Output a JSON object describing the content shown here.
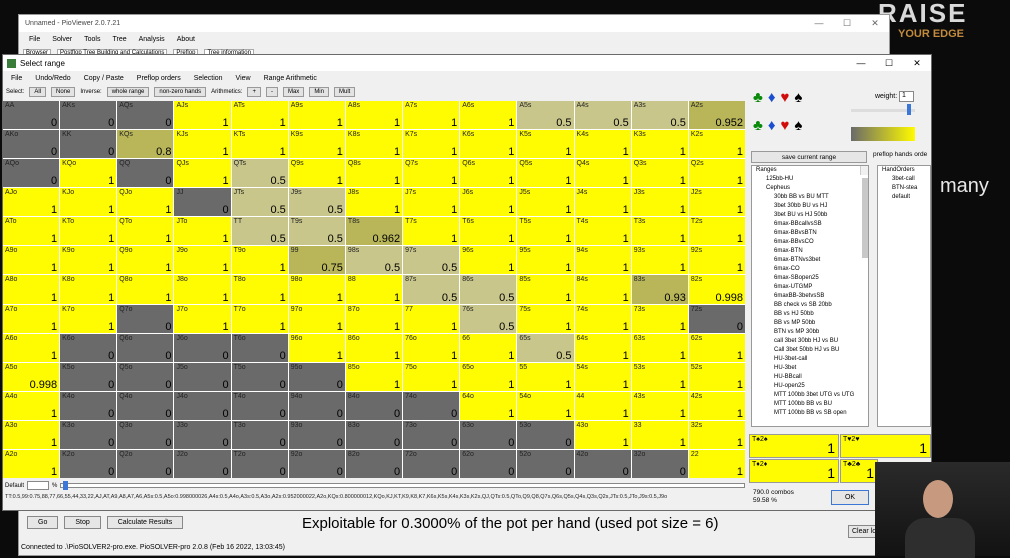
{
  "bg_window": {
    "title": "Unnamed - PioViewer 2.0.7.21",
    "menu": [
      "File",
      "Solver",
      "Tools",
      "Tree",
      "Analysis",
      "About"
    ],
    "tabs": [
      "Browser",
      "Postflop Tree Building and Calculations",
      "Preflop",
      "Tree information"
    ],
    "buttons": [
      "Go",
      "Stop",
      "Calculate Results"
    ],
    "explanation": "Exploitable for 0.3000% of the pot per hand (used pot size = 6)",
    "clear_log": "Clear log",
    "status": "Connected to .\\PioSOLVER2-pro.exe. PioSOLVER-pro 2.0.8 (Feb 16 2022, 13:03:45)"
  },
  "main_window": {
    "title": "Select range",
    "menu": [
      "File",
      "Undo/Redo",
      "Copy / Paste",
      "Preflop orders",
      "Selection",
      "View",
      "Range Arithmetic"
    ],
    "toolbar": {
      "select_label": "Select:",
      "all": "All",
      "none": "None",
      "inverse_label": "Inverse:",
      "whole_range": "whole range",
      "non_zero": "non-zero hands",
      "arith_label": "Arithmetics:",
      "plus": "+",
      "minus": "-",
      "max": "Max",
      "min": "Min",
      "mult": "Mult"
    },
    "default_label": "Default",
    "pct": "%",
    "range_string": "TT:0.5,99:0.75,88,77,66,55,44,33,22,AJ,AT,A9,A8,A7,A6,A5s:0.5,A5o:0.998000026,A4s:0.5,A4o,A3s:0.5,A3o,A2s:0.952000022,A2o,KQs:0.800000012,KQo,KJ,KT,K9,K8,K7,K6s,K5s,K4s,K3s,K2s,QJ,QTs:0.5,QTo,Q9,Q8,Q7s,Q6s,Q5s,Q4s,Q3s,Q2s,JTs:0.5,JTo,J9s:0.5,J9o"
  },
  "grid": [
    [
      [
        "AA",
        "0"
      ],
      [
        "AKs",
        "0"
      ],
      [
        "AQs",
        "0"
      ],
      [
        "AJs",
        "1"
      ],
      [
        "ATs",
        "1"
      ],
      [
        "A9s",
        "1"
      ],
      [
        "A8s",
        "1"
      ],
      [
        "A7s",
        "1"
      ],
      [
        "A6s",
        "1"
      ],
      [
        "A5s",
        "0.5"
      ],
      [
        "A4s",
        "0.5"
      ],
      [
        "A3s",
        "0.5"
      ],
      [
        "A2s",
        "0.952"
      ]
    ],
    [
      [
        "AKo",
        "0"
      ],
      [
        "KK",
        "0"
      ],
      [
        "KQs",
        "0.8"
      ],
      [
        "KJs",
        "1"
      ],
      [
        "KTs",
        "1"
      ],
      [
        "K9s",
        "1"
      ],
      [
        "K8s",
        "1"
      ],
      [
        "K7s",
        "1"
      ],
      [
        "K6s",
        "1"
      ],
      [
        "K5s",
        "1"
      ],
      [
        "K4s",
        "1"
      ],
      [
        "K3s",
        "1"
      ],
      [
        "K2s",
        "1"
      ]
    ],
    [
      [
        "AQo",
        "0"
      ],
      [
        "KQo",
        "1"
      ],
      [
        "QQ",
        "0"
      ],
      [
        "QJs",
        "1"
      ],
      [
        "QTs",
        "0.5"
      ],
      [
        "Q9s",
        "1"
      ],
      [
        "Q8s",
        "1"
      ],
      [
        "Q7s",
        "1"
      ],
      [
        "Q6s",
        "1"
      ],
      [
        "Q5s",
        "1"
      ],
      [
        "Q4s",
        "1"
      ],
      [
        "Q3s",
        "1"
      ],
      [
        "Q2s",
        "1"
      ]
    ],
    [
      [
        "AJo",
        "1"
      ],
      [
        "KJo",
        "1"
      ],
      [
        "QJo",
        "1"
      ],
      [
        "JJ",
        "0"
      ],
      [
        "JTs",
        "0.5"
      ],
      [
        "J9s",
        "0.5"
      ],
      [
        "J8s",
        "1"
      ],
      [
        "J7s",
        "1"
      ],
      [
        "J6s",
        "1"
      ],
      [
        "J5s",
        "1"
      ],
      [
        "J4s",
        "1"
      ],
      [
        "J3s",
        "1"
      ],
      [
        "J2s",
        "1"
      ]
    ],
    [
      [
        "ATo",
        "1"
      ],
      [
        "KTo",
        "1"
      ],
      [
        "QTo",
        "1"
      ],
      [
        "JTo",
        "1"
      ],
      [
        "TT",
        "0.5"
      ],
      [
        "T9s",
        "0.5"
      ],
      [
        "T8s",
        "0.962"
      ],
      [
        "T7s",
        "1"
      ],
      [
        "T6s",
        "1"
      ],
      [
        "T5s",
        "1"
      ],
      [
        "T4s",
        "1"
      ],
      [
        "T3s",
        "1"
      ],
      [
        "T2s",
        "1"
      ]
    ],
    [
      [
        "A9o",
        "1"
      ],
      [
        "K9o",
        "1"
      ],
      [
        "Q9o",
        "1"
      ],
      [
        "J9o",
        "1"
      ],
      [
        "T9o",
        "1"
      ],
      [
        "99",
        "0.75"
      ],
      [
        "98s",
        "0.5"
      ],
      [
        "97s",
        "0.5"
      ],
      [
        "96s",
        "1"
      ],
      [
        "95s",
        "1"
      ],
      [
        "94s",
        "1"
      ],
      [
        "93s",
        "1"
      ],
      [
        "92s",
        "1"
      ]
    ],
    [
      [
        "A8o",
        "1"
      ],
      [
        "K8o",
        "1"
      ],
      [
        "Q8o",
        "1"
      ],
      [
        "J8o",
        "1"
      ],
      [
        "T8o",
        "1"
      ],
      [
        "98o",
        "1"
      ],
      [
        "88",
        "1"
      ],
      [
        "87s",
        "0.5"
      ],
      [
        "86s",
        "0.5"
      ],
      [
        "85s",
        "1"
      ],
      [
        "84s",
        "1"
      ],
      [
        "83s",
        "0.93"
      ],
      [
        "82s",
        "0.998"
      ]
    ],
    [
      [
        "A7o",
        "1"
      ],
      [
        "K7o",
        "1"
      ],
      [
        "Q7o",
        "0"
      ],
      [
        "J7o",
        "1"
      ],
      [
        "T7o",
        "1"
      ],
      [
        "97o",
        "1"
      ],
      [
        "87o",
        "1"
      ],
      [
        "77",
        "1"
      ],
      [
        "76s",
        "0.5"
      ],
      [
        "75s",
        "1"
      ],
      [
        "74s",
        "1"
      ],
      [
        "73s",
        "1"
      ],
      [
        "72s",
        "0"
      ]
    ],
    [
      [
        "A6o",
        "1"
      ],
      [
        "K6o",
        "0"
      ],
      [
        "Q6o",
        "0"
      ],
      [
        "J6o",
        "0"
      ],
      [
        "T6o",
        "0"
      ],
      [
        "96o",
        "1"
      ],
      [
        "86o",
        "1"
      ],
      [
        "76o",
        "1"
      ],
      [
        "66",
        "1"
      ],
      [
        "65s",
        "0.5"
      ],
      [
        "64s",
        "1"
      ],
      [
        "63s",
        "1"
      ],
      [
        "62s",
        "1"
      ]
    ],
    [
      [
        "A5o",
        "0.998"
      ],
      [
        "K5o",
        "0"
      ],
      [
        "Q5o",
        "0"
      ],
      [
        "J5o",
        "0"
      ],
      [
        "T5o",
        "0"
      ],
      [
        "95o",
        "0"
      ],
      [
        "85o",
        "1"
      ],
      [
        "75o",
        "1"
      ],
      [
        "65o",
        "1"
      ],
      [
        "55",
        "1"
      ],
      [
        "54s",
        "1"
      ],
      [
        "53s",
        "1"
      ],
      [
        "52s",
        "1"
      ]
    ],
    [
      [
        "A4o",
        "1"
      ],
      [
        "K4o",
        "0"
      ],
      [
        "Q4o",
        "0"
      ],
      [
        "J4o",
        "0"
      ],
      [
        "T4o",
        "0"
      ],
      [
        "94o",
        "0"
      ],
      [
        "84o",
        "0"
      ],
      [
        "74o",
        "0"
      ],
      [
        "64o",
        "1"
      ],
      [
        "54o",
        "1"
      ],
      [
        "44",
        "1"
      ],
      [
        "43s",
        "1"
      ],
      [
        "42s",
        "1"
      ]
    ],
    [
      [
        "A3o",
        "1"
      ],
      [
        "K3o",
        "0"
      ],
      [
        "Q3o",
        "0"
      ],
      [
        "J3o",
        "0"
      ],
      [
        "T3o",
        "0"
      ],
      [
        "93o",
        "0"
      ],
      [
        "83o",
        "0"
      ],
      [
        "73o",
        "0"
      ],
      [
        "63o",
        "0"
      ],
      [
        "53o",
        "0"
      ],
      [
        "43o",
        "1"
      ],
      [
        "33",
        "1"
      ],
      [
        "32s",
        "1"
      ]
    ],
    [
      [
        "A2o",
        "1"
      ],
      [
        "K2o",
        "0"
      ],
      [
        "Q2o",
        "0"
      ],
      [
        "J2o",
        "0"
      ],
      [
        "T2o",
        "0"
      ],
      [
        "92o",
        "0"
      ],
      [
        "82o",
        "0"
      ],
      [
        "72o",
        "0"
      ],
      [
        "62o",
        "0"
      ],
      [
        "52o",
        "0"
      ],
      [
        "42o",
        "0"
      ],
      [
        "32o",
        "0"
      ],
      [
        "22",
        "1"
      ]
    ]
  ],
  "right_panel": {
    "weight_label": "weight:",
    "weight_value": "1",
    "save_btn": "save current range",
    "preflop_label": "preflop hands orde",
    "tree": [
      "Ranges",
      "125bb-HU",
      "Cepheus",
      "30bb BB vs BU MTT",
      "3bet 30bb BU vs HJ",
      "3bet BU vs HJ 50bb",
      "6max-BBcallvsSB",
      "6max-BBvsBTN",
      "6max-BBvsCO",
      "6max-BTN",
      "6max-BTNvs3bet",
      "6max-CO",
      "6max-SBopen25",
      "6max-UTGMP",
      "6maxBB-3betvsSB",
      "BB check vs SB 20bb",
      "BB vs HJ 50bb",
      "BB vs MP 50bb",
      "BTN vs MP 30bb",
      "call 3bet 30bb HJ vs BU",
      "Call 3bet 50bb HJ vs BU",
      "HU-3bet-call",
      "HU-3bet",
      "HU-BBcall",
      "HU-open25",
      "MTT 100bb 3bet UTG vs UTG",
      "MTT 100bb BB vs BU",
      "MTT 100bb BB vs SB open"
    ],
    "tree2": [
      "HandOrders",
      "3bet-call",
      "BTN-stea",
      "default"
    ],
    "combos": [
      {
        "name": "T♠2♠",
        "value": "1"
      },
      {
        "name": "T♥2♥",
        "value": "1"
      },
      {
        "name": "T♦2♦",
        "value": "1"
      },
      {
        "name": "T♣2♣",
        "value": "1"
      }
    ],
    "combo_count": "790.0 combos",
    "combo_pct": "59.58 %",
    "ok": "OK"
  },
  "logo": {
    "line1": "RAISE",
    "line2": "YOUR EDGE"
  },
  "side_text": "many",
  "colors": {
    "yellow": "#fffb00",
    "gray": "#6a6a6a",
    "khaki": "#c9c68b",
    "olive": "#b9b65a"
  }
}
